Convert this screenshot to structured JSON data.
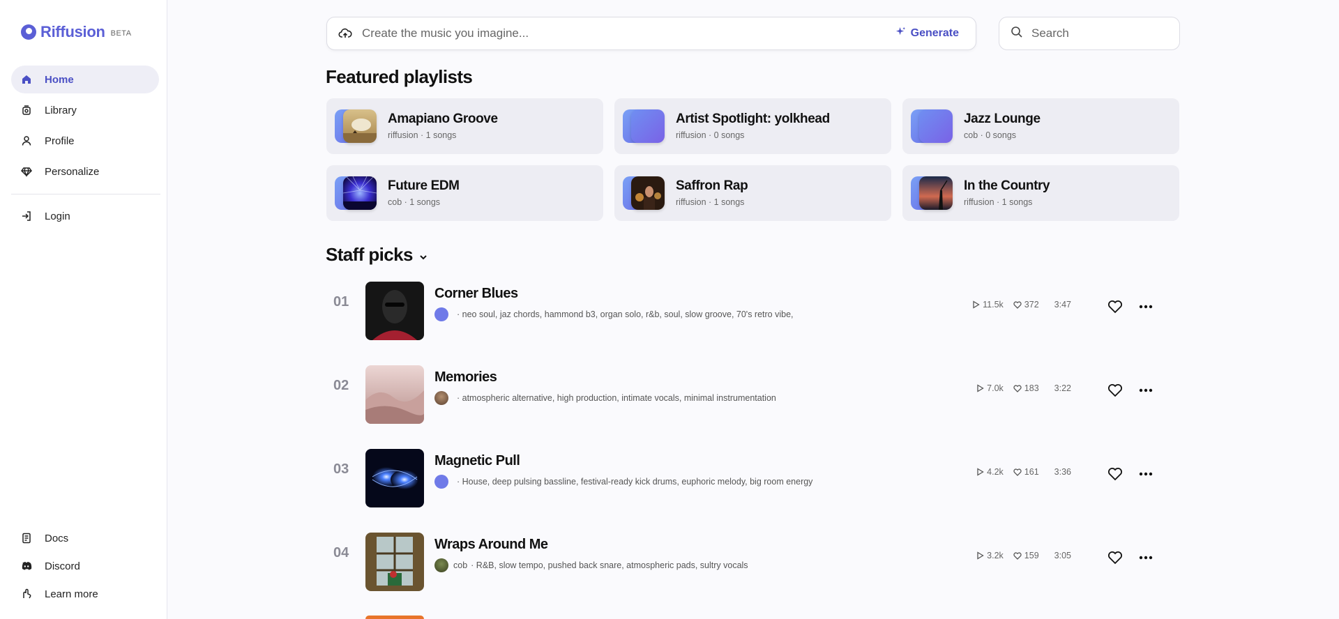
{
  "brand": {
    "name": "Riffusion",
    "badge": "BETA",
    "accent": "#4a4fc4"
  },
  "sidebar": {
    "items": [
      {
        "label": "Home",
        "icon": "home-icon",
        "active": true
      },
      {
        "label": "Library",
        "icon": "library-icon"
      },
      {
        "label": "Profile",
        "icon": "user-icon"
      },
      {
        "label": "Personalize",
        "icon": "gem-icon"
      }
    ],
    "login": {
      "label": "Login",
      "icon": "login-icon"
    },
    "bottom": [
      {
        "label": "Docs",
        "icon": "docs-icon"
      },
      {
        "label": "Discord",
        "icon": "discord-icon"
      },
      {
        "label": "Learn more",
        "icon": "learn-more-icon"
      }
    ]
  },
  "create": {
    "placeholder": "Create the music you imagine...",
    "generate_label": "Generate"
  },
  "search": {
    "placeholder": "Search"
  },
  "featured": {
    "title": "Featured playlists",
    "playlists": [
      {
        "name": "Amapiano Groove",
        "meta": "riffusion · 1 songs"
      },
      {
        "name": "Artist Spotlight: yolkhead",
        "meta": "riffusion · 0 songs"
      },
      {
        "name": "Jazz Lounge",
        "meta": "cob · 0 songs"
      },
      {
        "name": "Future EDM",
        "meta": "cob · 1 songs"
      },
      {
        "name": "Saffron Rap",
        "meta": "riffusion · 1 songs"
      },
      {
        "name": "In the Country",
        "meta": "riffusion · 1 songs"
      }
    ]
  },
  "staff_picks": {
    "title": "Staff picks",
    "tracks": [
      {
        "num": "01",
        "title": "Corner Blues",
        "author": "",
        "tags": "· neo soul, jaz chords, hammond b3, organ solo, r&b, soul, slow groove, 70's retro vibe,",
        "plays": "11.5k",
        "likes": "372",
        "duration": "3:47"
      },
      {
        "num": "02",
        "title": "Memories",
        "author": "",
        "tags": "· atmospheric alternative, high production, intimate vocals, minimal instrumentation",
        "plays": "7.0k",
        "likes": "183",
        "duration": "3:22"
      },
      {
        "num": "03",
        "title": "Magnetic Pull",
        "author": "",
        "tags": "· House, deep pulsing bassline, festival-ready kick drums, euphoric melody, big room energy",
        "plays": "4.2k",
        "likes": "161",
        "duration": "3:36"
      },
      {
        "num": "04",
        "title": "Wraps Around Me",
        "author": "cob",
        "tags": "· R&B, slow tempo, pushed back snare, atmospheric pads, sultry vocals",
        "plays": "3.2k",
        "likes": "159",
        "duration": "3:05"
      }
    ]
  }
}
